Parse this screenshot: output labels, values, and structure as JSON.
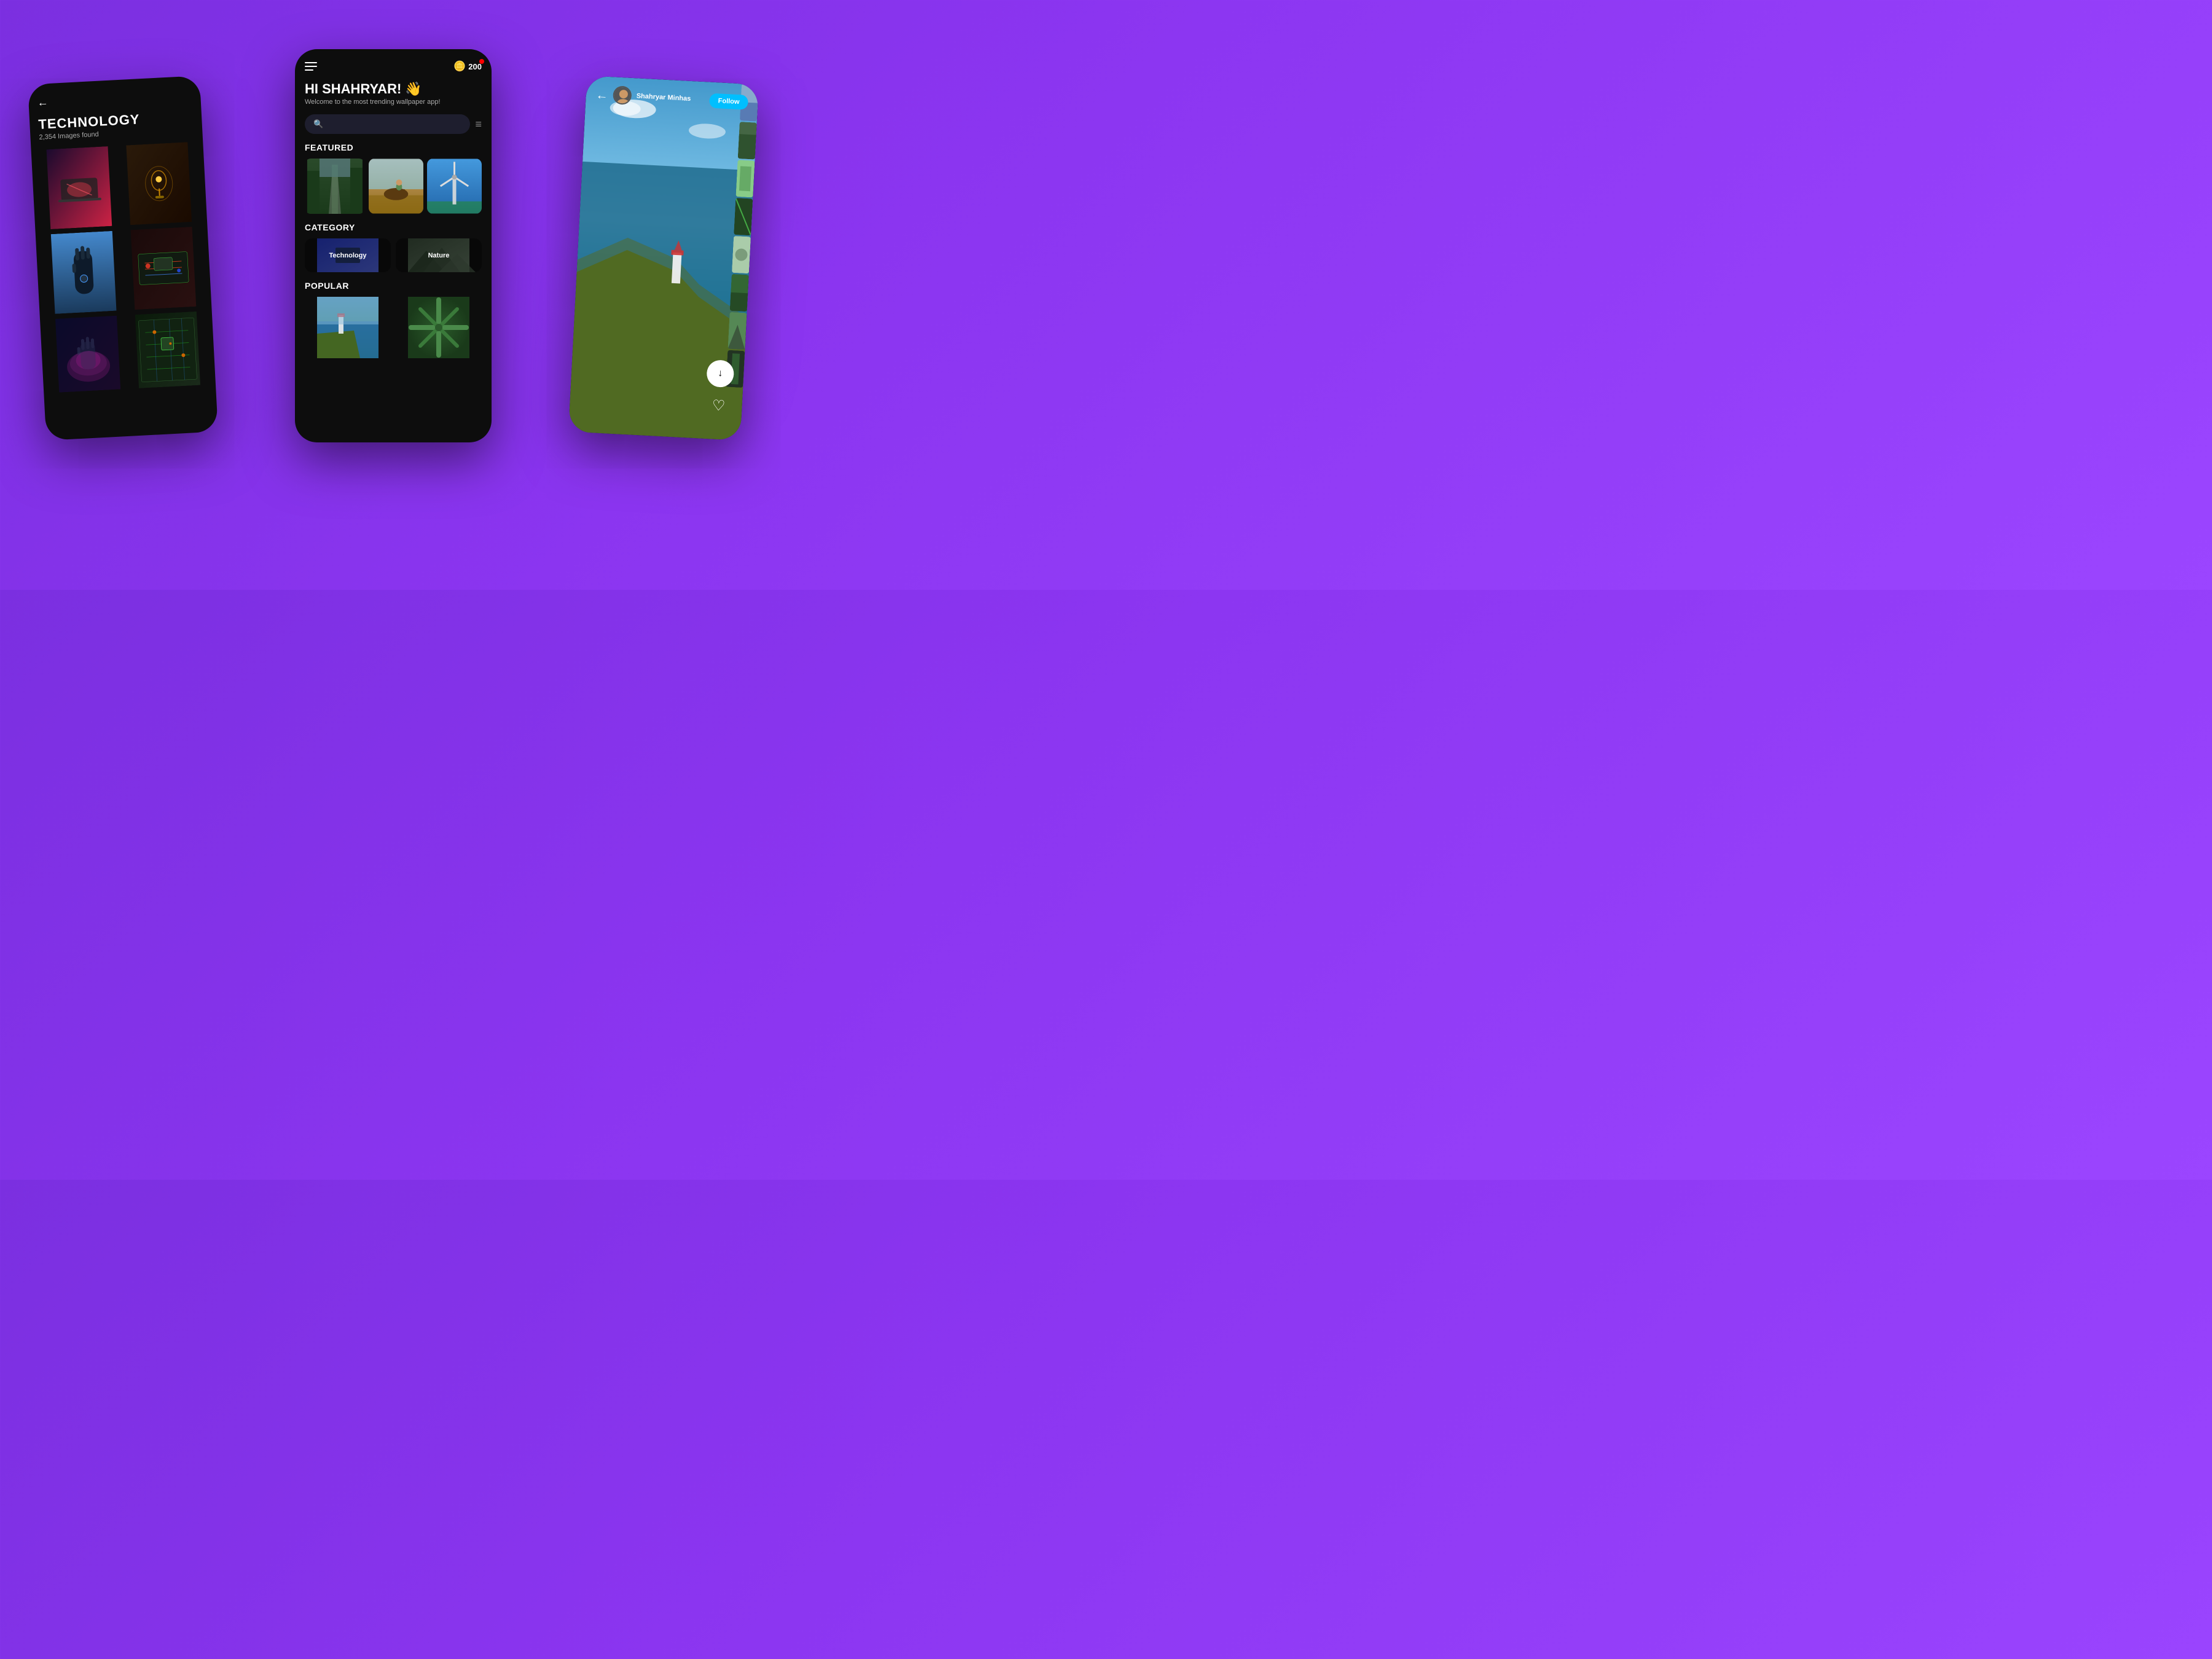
{
  "background": {
    "gradient": "purple"
  },
  "left_phone": {
    "back_label": "←",
    "title": "TECHNOLOGY",
    "count": "2,354 Images found",
    "images": [
      {
        "id": "laptop",
        "color1": "#1a0a2e",
        "color2": "#cc2244"
      },
      {
        "id": "bulb",
        "color1": "#2a1a0a",
        "color2": "#cc8800"
      },
      {
        "id": "hand",
        "color1": "#1a3a5c",
        "color2": "#2244cc"
      },
      {
        "id": "pcparts",
        "color1": "#2a0a0a",
        "color2": "#cc4422"
      },
      {
        "id": "glowhand",
        "color1": "#0a0a2a",
        "color2": "#cc22aa"
      },
      {
        "id": "circuit",
        "color1": "#0a1a0a",
        "color2": "#22aa44"
      }
    ]
  },
  "center_phone": {
    "menu_label": "menu",
    "coin_emoji": "🪙",
    "coin_count": "200",
    "greeting": "HI SHAHRYAR! 👋",
    "welcome": "Welcome to the most trending wallpaper app!",
    "search_placeholder": "",
    "filter_icon": "≡",
    "featured_label": "FEATURED",
    "category_label": "CATEGORY",
    "popular_label": "POPULAR",
    "categories": [
      {
        "label": "Technology"
      },
      {
        "label": "Nature"
      }
    ],
    "featured_images": [
      {
        "id": "forest",
        "color1": "#1a3a1a",
        "color2": "#2d5a2d"
      },
      {
        "id": "horse",
        "color1": "#c8a87a",
        "color2": "#8B6914"
      },
      {
        "id": "windmill",
        "color1": "#4488cc",
        "color2": "#2266aa"
      }
    ],
    "popular_images": [
      {
        "id": "lighthouse",
        "color1": "#4488aa",
        "color2": "#2a7a5a"
      },
      {
        "id": "plant",
        "color1": "#1a4a1a",
        "color2": "#2a7a2a"
      }
    ]
  },
  "right_phone": {
    "back_label": "←",
    "username": "Shahryar Minhas",
    "follow_label": "Follow",
    "download_icon": "↓",
    "heart_icon": "♡",
    "main_image": {
      "color1": "#2a6688",
      "color2": "#3a8855"
    },
    "side_images": [
      {
        "color": "#88aacc"
      },
      {
        "color": "#446644"
      },
      {
        "color": "#88cc88"
      },
      {
        "color": "#224422"
      },
      {
        "color": "#aaccaa"
      },
      {
        "color": "#336633"
      },
      {
        "color": "#558855"
      },
      {
        "color": "#223322"
      }
    ]
  }
}
